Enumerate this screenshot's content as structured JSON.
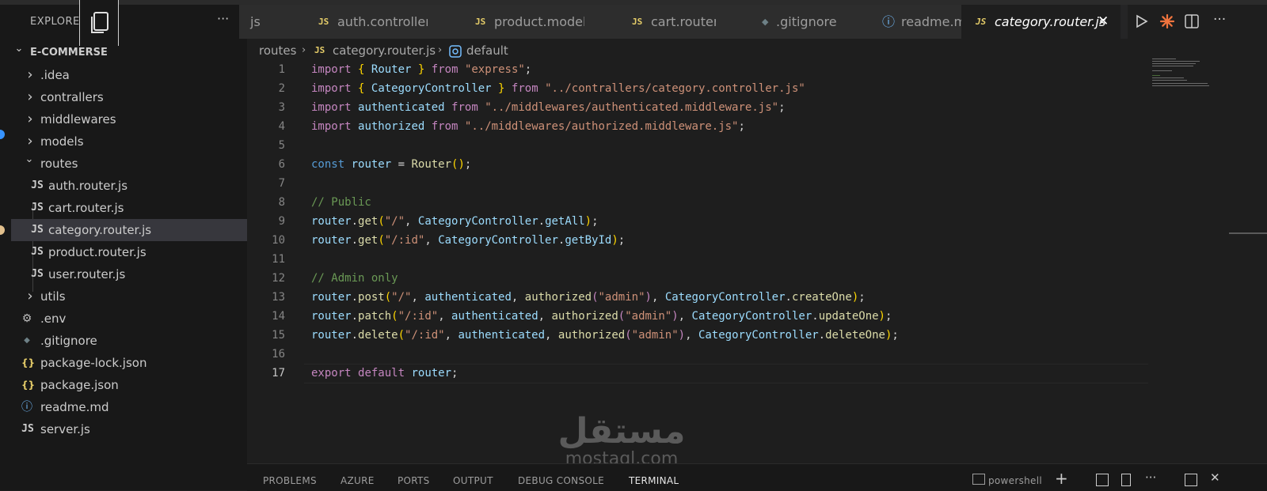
{
  "sidebar": {
    "title": "EXPLORER",
    "more": "···",
    "tree": [
      {
        "label": "E-COMMERSE",
        "type": "root",
        "depth": 0
      },
      {
        "label": ".idea",
        "type": "folder",
        "depth": 1
      },
      {
        "label": "contrallers",
        "type": "folder",
        "depth": 1
      },
      {
        "label": "middlewares",
        "type": "folder",
        "depth": 1
      },
      {
        "label": "models",
        "type": "folder",
        "depth": 1
      },
      {
        "label": "routes",
        "type": "folder-open",
        "depth": 1
      },
      {
        "label": "auth.router.js",
        "type": "js",
        "depth": 2
      },
      {
        "label": "cart.router.js",
        "type": "js",
        "depth": 2
      },
      {
        "label": "category.router.js",
        "type": "js",
        "depth": 2,
        "selected": true
      },
      {
        "label": "product.router.js",
        "type": "js",
        "depth": 2
      },
      {
        "label": "user.router.js",
        "type": "js",
        "depth": 2
      },
      {
        "label": "utils",
        "type": "folder",
        "depth": 1
      },
      {
        "label": ".env",
        "type": "gear",
        "depth": 1
      },
      {
        "label": ".gitignore",
        "type": "git",
        "depth": 1
      },
      {
        "label": "package-lock.json",
        "type": "json",
        "depth": 1
      },
      {
        "label": "package.json",
        "type": "json",
        "depth": 1
      },
      {
        "label": "readme.md",
        "type": "info",
        "depth": 1
      },
      {
        "label": "server.js",
        "type": "js",
        "depth": 1
      }
    ]
  },
  "tabs": [
    {
      "label": "js",
      "icon": "none"
    },
    {
      "label": "auth.controller.js",
      "icon": "JS"
    },
    {
      "label": "product.model.js",
      "icon": "JS"
    },
    {
      "label": "cart.router.js",
      "icon": "JS"
    },
    {
      "label": ".gitignore",
      "icon": "git"
    },
    {
      "label": "readme.md",
      "icon": "info"
    },
    {
      "label": "category.router.js",
      "icon": "JS",
      "active": true
    }
  ],
  "tab_close": "✕",
  "js_badge": "JS",
  "breadcrumb": {
    "folder": "routes",
    "file": "category.router.js",
    "symbol": "default"
  },
  "editor": {
    "current_line": 17,
    "lines": [
      [
        [
          "kw",
          "import"
        ],
        [
          "d",
          " "
        ],
        [
          "br",
          "{"
        ],
        [
          "d",
          " "
        ],
        [
          "vr",
          "Router"
        ],
        [
          "d",
          " "
        ],
        [
          "br",
          "}"
        ],
        [
          "d",
          " "
        ],
        [
          "kw",
          "from"
        ],
        [
          "d",
          " "
        ],
        [
          "st",
          "\"express\""
        ],
        [
          "d",
          ";"
        ]
      ],
      [
        [
          "kw",
          "import"
        ],
        [
          "d",
          " "
        ],
        [
          "br",
          "{"
        ],
        [
          "d",
          " "
        ],
        [
          "vr",
          "CategoryController"
        ],
        [
          "d",
          " "
        ],
        [
          "br",
          "}"
        ],
        [
          "d",
          " "
        ],
        [
          "kw",
          "from"
        ],
        [
          "d",
          " "
        ],
        [
          "st",
          "\"../contrallers/category.controller.js\""
        ]
      ],
      [
        [
          "kw",
          "import"
        ],
        [
          "d",
          " "
        ],
        [
          "vr",
          "authenticated"
        ],
        [
          "d",
          " "
        ],
        [
          "kw",
          "from"
        ],
        [
          "d",
          " "
        ],
        [
          "st",
          "\"../middlewares/authenticated.middleware.js\""
        ],
        [
          "d",
          ";"
        ]
      ],
      [
        [
          "kw",
          "import"
        ],
        [
          "d",
          " "
        ],
        [
          "vr",
          "authorized"
        ],
        [
          "d",
          " "
        ],
        [
          "kw",
          "from"
        ],
        [
          "d",
          " "
        ],
        [
          "st",
          "\"../middlewares/authorized.middleware.js\""
        ],
        [
          "d",
          ";"
        ]
      ],
      [],
      [
        [
          "kb",
          "const"
        ],
        [
          "d",
          " "
        ],
        [
          "vr",
          "router"
        ],
        [
          "d",
          " = "
        ],
        [
          "fn",
          "Router"
        ],
        [
          "br",
          "()"
        ],
        [
          "d",
          ";"
        ]
      ],
      [],
      [
        [
          "cm",
          "// Public"
        ]
      ],
      [
        [
          "vr",
          "router"
        ],
        [
          "d",
          "."
        ],
        [
          "fn",
          "get"
        ],
        [
          "br",
          "("
        ],
        [
          "st",
          "\"/\""
        ],
        [
          "d",
          ", "
        ],
        [
          "vr",
          "CategoryController"
        ],
        [
          "d",
          "."
        ],
        [
          "vr",
          "getAll"
        ],
        [
          "br",
          ")"
        ],
        [
          "d",
          ";"
        ]
      ],
      [
        [
          "vr",
          "router"
        ],
        [
          "d",
          "."
        ],
        [
          "fn",
          "get"
        ],
        [
          "br",
          "("
        ],
        [
          "st",
          "\"/:id\""
        ],
        [
          "d",
          ", "
        ],
        [
          "vr",
          "CategoryController"
        ],
        [
          "d",
          "."
        ],
        [
          "vr",
          "getById"
        ],
        [
          "br",
          ")"
        ],
        [
          "d",
          ";"
        ]
      ],
      [],
      [
        [
          "cm",
          "// Admin only"
        ]
      ],
      [
        [
          "vr",
          "router"
        ],
        [
          "d",
          "."
        ],
        [
          "fn",
          "post"
        ],
        [
          "br",
          "("
        ],
        [
          "st",
          "\"/\""
        ],
        [
          "d",
          ", "
        ],
        [
          "vr",
          "authenticated"
        ],
        [
          "d",
          ", "
        ],
        [
          "fn",
          "authorized"
        ],
        [
          "kw",
          "("
        ],
        [
          "st",
          "\"admin\""
        ],
        [
          "kw",
          ")"
        ],
        [
          "d",
          ", "
        ],
        [
          "vr",
          "CategoryController"
        ],
        [
          "d",
          "."
        ],
        [
          "fn",
          "createOne"
        ],
        [
          "br",
          ")"
        ],
        [
          "d",
          ";"
        ]
      ],
      [
        [
          "vr",
          "router"
        ],
        [
          "d",
          "."
        ],
        [
          "fn",
          "patch"
        ],
        [
          "br",
          "("
        ],
        [
          "st",
          "\"/:id\""
        ],
        [
          "d",
          ", "
        ],
        [
          "vr",
          "authenticated"
        ],
        [
          "d",
          ", "
        ],
        [
          "fn",
          "authorized"
        ],
        [
          "kw",
          "("
        ],
        [
          "st",
          "\"admin\""
        ],
        [
          "kw",
          ")"
        ],
        [
          "d",
          ", "
        ],
        [
          "vr",
          "CategoryController"
        ],
        [
          "d",
          "."
        ],
        [
          "fn",
          "updateOne"
        ],
        [
          "br",
          ")"
        ],
        [
          "d",
          ";"
        ]
      ],
      [
        [
          "vr",
          "router"
        ],
        [
          "d",
          "."
        ],
        [
          "fn",
          "delete"
        ],
        [
          "br",
          "("
        ],
        [
          "st",
          "\"/:id\""
        ],
        [
          "d",
          ", "
        ],
        [
          "vr",
          "authenticated"
        ],
        [
          "d",
          ", "
        ],
        [
          "fn",
          "authorized"
        ],
        [
          "kw",
          "("
        ],
        [
          "st",
          "\"admin\""
        ],
        [
          "kw",
          ")"
        ],
        [
          "d",
          ", "
        ],
        [
          "vr",
          "CategoryController"
        ],
        [
          "d",
          "."
        ],
        [
          "fn",
          "deleteOne"
        ],
        [
          "br",
          ")"
        ],
        [
          "d",
          ";"
        ]
      ],
      [],
      [
        [
          "kw",
          "export"
        ],
        [
          "d",
          " "
        ],
        [
          "kw",
          "default"
        ],
        [
          "d",
          " "
        ],
        [
          "vr",
          "router"
        ],
        [
          "d",
          ";"
        ]
      ]
    ]
  },
  "panel_tabs": [
    {
      "label": "PROBLEMS"
    },
    {
      "label": "AZURE"
    },
    {
      "label": "PORTS"
    },
    {
      "label": "OUTPUT"
    },
    {
      "label": "DEBUG CONSOLE"
    },
    {
      "label": "TERMINAL",
      "active": true
    }
  ],
  "panel_shell": "powershell",
  "watermark": {
    "arabic": "مستقل",
    "latin": "mostaql.com"
  },
  "colors": {
    "keyword": "#c586c0",
    "string": "#ce9178",
    "comment": "#6a9955",
    "variable": "#9cdcfe",
    "function": "#dcdcaa",
    "bracket": "#ffd700",
    "js_badge": "#e6cd69"
  }
}
